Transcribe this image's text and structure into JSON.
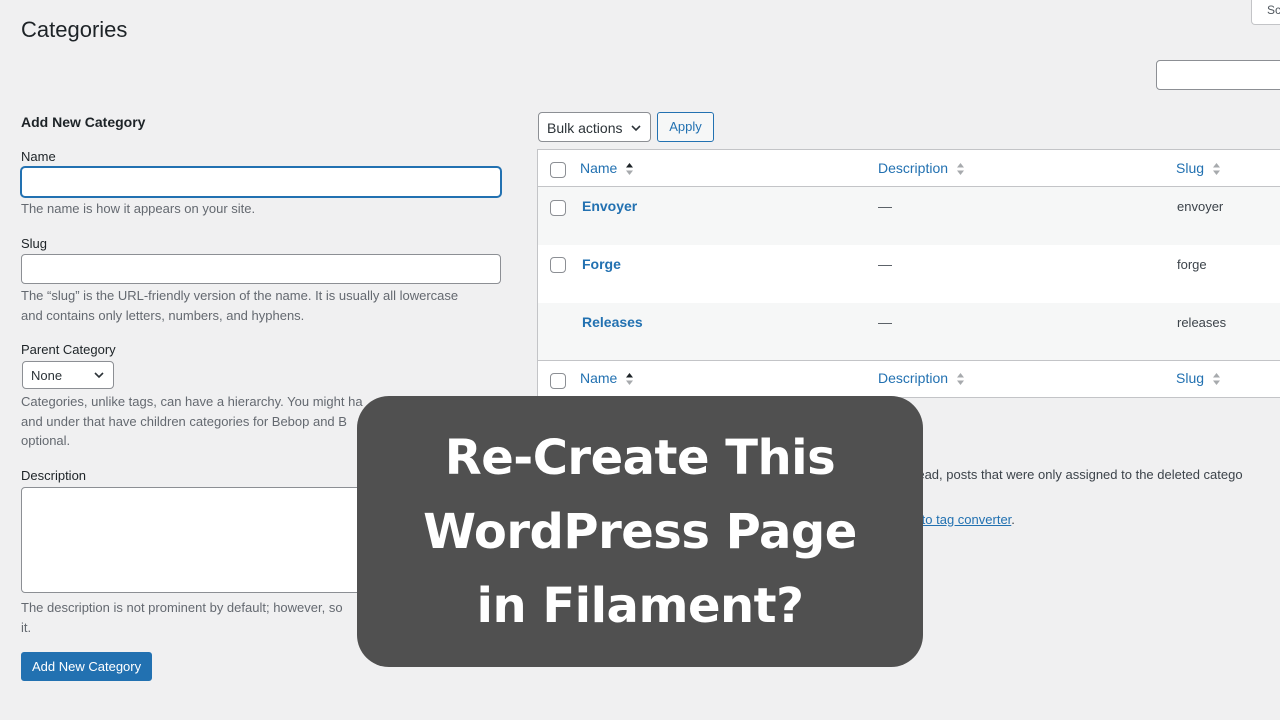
{
  "page": {
    "title": "Categories",
    "screen_options_label": "Screen Options"
  },
  "form": {
    "heading": "Add New Category",
    "name_label": "Name",
    "name_value": "",
    "name_help": "The name is how it appears on your site.",
    "slug_label": "Slug",
    "slug_value": "",
    "slug_help_1": "The “slug” is the URL-friendly version of the name. It is usually all lowercase",
    "slug_help_2": "and contains only letters, numbers, and hyphens.",
    "parent_label": "Parent Category",
    "parent_selected": "None",
    "parent_help_1": "Categories, unlike tags, can have a hierarchy. You might ha",
    "parent_help_2": "and under that have children categories for Bebop and B",
    "parent_help_3": "optional.",
    "description_label": "Description",
    "description_value": "",
    "description_help_1": "The description is not prominent by default; however, so",
    "description_help_2": "it.",
    "submit_label": "Add New Category"
  },
  "toolbar": {
    "bulk_actions_selected": "Bulk actions",
    "apply_label": "Apply"
  },
  "table": {
    "columns": [
      "Name",
      "Description",
      "Slug"
    ],
    "rows": [
      {
        "name": "Envoyer",
        "description": "—",
        "slug": "envoyer",
        "has_checkbox": true
      },
      {
        "name": "Forge",
        "description": "—",
        "slug": "forge",
        "has_checkbox": true
      },
      {
        "name": "Releases",
        "description": "—",
        "slug": "releases",
        "has_checkbox": false
      }
    ]
  },
  "notes": {
    "delete_note": "nstead, posts that were only assigned to the deleted catego",
    "converter_link": "ory to tag converter",
    "converter_suffix": "."
  },
  "overlay": {
    "line1": "Re-Create This",
    "line2": "WordPress Page",
    "line3": "in Filament?"
  },
  "colors": {
    "accent": "#2271b1",
    "background": "#f0f0f1",
    "overlay": "#505050"
  }
}
